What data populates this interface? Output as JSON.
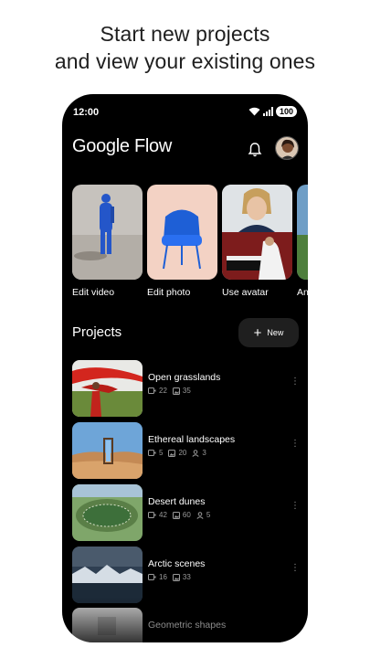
{
  "headline": {
    "line1": "Start new projects",
    "line2": "and view your existing ones"
  },
  "status_bar": {
    "time": "12:00",
    "battery": "100"
  },
  "app": {
    "title": "Google Flow"
  },
  "quick_actions": [
    {
      "label": "Edit video"
    },
    {
      "label": "Edit photo"
    },
    {
      "label": "Use avatar"
    },
    {
      "label": "An"
    }
  ],
  "projects_section": {
    "title": "Projects",
    "new_label": "New"
  },
  "projects": [
    {
      "title": "Open grasslands",
      "videos": "22",
      "images": "35",
      "people": ""
    },
    {
      "title": "Ethereal landscapes",
      "videos": "5",
      "images": "20",
      "people": "3"
    },
    {
      "title": "Desert dunes",
      "videos": "42",
      "images": "60",
      "people": "5"
    },
    {
      "title": "Arctic scenes",
      "videos": "16",
      "images": "33",
      "people": ""
    },
    {
      "title": "Geometric shapes",
      "videos": "",
      "images": "",
      "people": ""
    }
  ],
  "colors": {
    "screen_bg": "#000000",
    "button_bg": "#1f1f1f",
    "text": "#ffffff",
    "muted": "#9a9a9a"
  }
}
